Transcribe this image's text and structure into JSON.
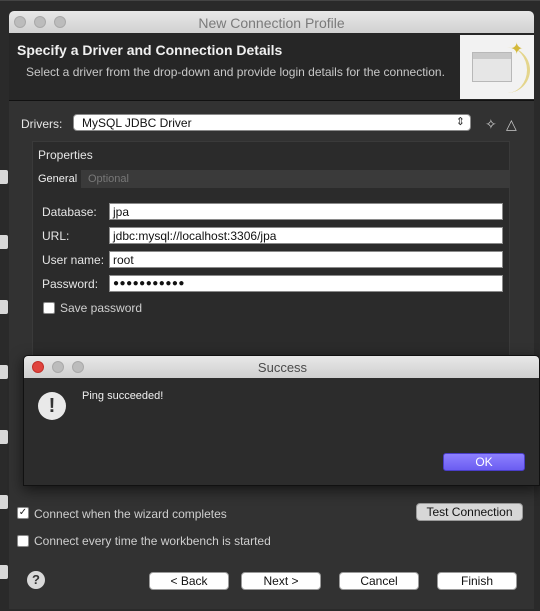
{
  "window": {
    "title": "New Connection Profile"
  },
  "header": {
    "title": "Specify a Driver and Connection Details",
    "description": "Select a driver from the drop-down and provide login details for the connection."
  },
  "drivers": {
    "label": "Drivers:",
    "selected": "MySQL JDBC Driver"
  },
  "properties": {
    "title": "Properties",
    "tabs": [
      {
        "label": "General",
        "active": true
      },
      {
        "label": "Optional",
        "active": false
      }
    ],
    "fields": [
      {
        "label": "Database:",
        "value": "jpa"
      },
      {
        "label": "URL:",
        "value": "jdbc:mysql://localhost:3306/jpa"
      },
      {
        "label": "User name:",
        "value": "root"
      },
      {
        "label": "Password:",
        "value": "●●●●●●●●●●●"
      }
    ],
    "save_password": {
      "label": "Save password",
      "checked": false
    }
  },
  "options": {
    "connect_on_complete": {
      "label": "Connect when the wizard completes",
      "checked": true
    },
    "connect_every_time": {
      "label": "Connect every time the workbench is started",
      "checked": false
    }
  },
  "test_connection_label": "Test Connection",
  "buttons": {
    "back": "< Back",
    "next": "Next >",
    "cancel": "Cancel",
    "finish": "Finish"
  },
  "dialog": {
    "title": "Success",
    "message": "Ping succeeded!",
    "ok_label": "OK",
    "icon": "exclamation-icon"
  },
  "colors": {
    "ok_button": "#6b5df1",
    "window_bg": "#323232"
  }
}
